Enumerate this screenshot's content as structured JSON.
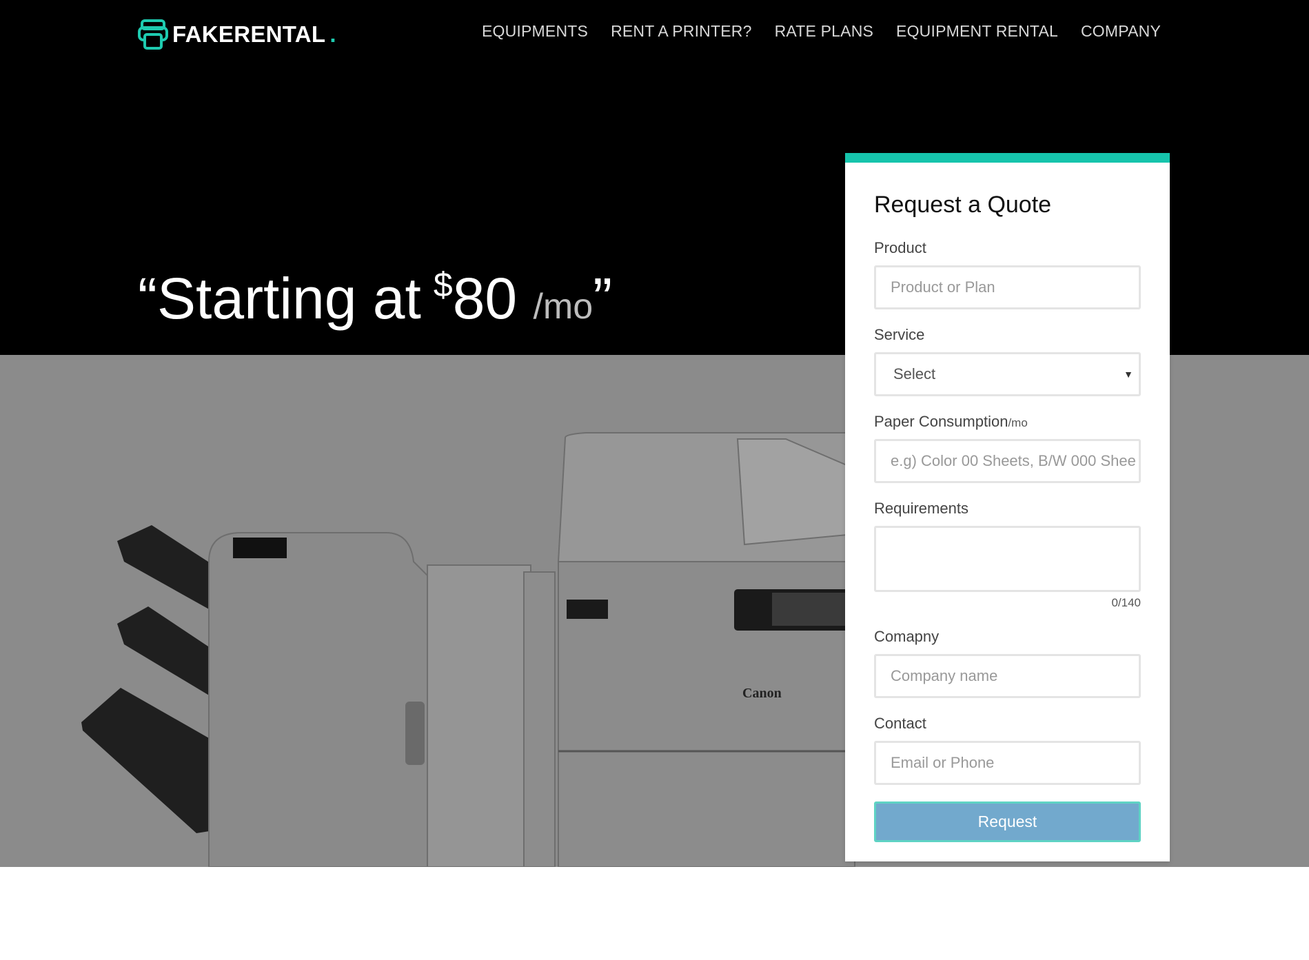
{
  "brand": {
    "name": "FAKERENTAL",
    "dot": ".",
    "accent": "#1ecbb0"
  },
  "nav": {
    "items": [
      {
        "label": "EQUIPMENTS"
      },
      {
        "label": "RENT A PRINTER?"
      },
      {
        "label": "RATE PLANS"
      },
      {
        "label": "EQUIPMENT RENTAL"
      },
      {
        "label": "COMPANY"
      }
    ]
  },
  "hero": {
    "open_quote": "“",
    "text": "Starting at",
    "currency": "$",
    "price": "80",
    "unit": "/mo",
    "close_quote": "”",
    "printer_brand": "Canon"
  },
  "form": {
    "title": "Request a Quote",
    "product": {
      "label": "Product",
      "placeholder": "Product or Plan",
      "value": ""
    },
    "service": {
      "label": "Service",
      "value": "Select"
    },
    "paper": {
      "label": "Paper Consumption",
      "label_suffix": "/mo",
      "placeholder": "e.g) Color 00 Sheets, B/W 000 Shee",
      "value": ""
    },
    "requirements": {
      "label": "Requirements",
      "value": "",
      "counter": "0/140"
    },
    "company": {
      "label": "Comapny",
      "placeholder": "Company name",
      "value": ""
    },
    "contact": {
      "label": "Contact",
      "placeholder": "Email or Phone",
      "value": ""
    },
    "submit_label": "Request",
    "colors": {
      "top_border": "#16c4ac",
      "button": "#72a9cd",
      "button_border": "#5fd3c4"
    }
  }
}
